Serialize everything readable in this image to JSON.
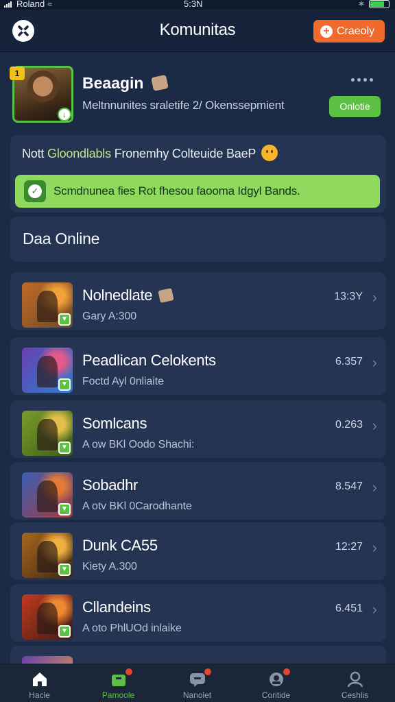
{
  "status_bar": {
    "carrier": "Roland",
    "time": "5:3N",
    "battery_level": 0.78,
    "battery_color": "#3ecf4a"
  },
  "header": {
    "title": "Komunitas",
    "create_label": "Craeoly",
    "create_color": "#ef6a2c"
  },
  "profile": {
    "name": "Beaagin",
    "subtitle": "Meltnnunites sraletife 2/ Okenssepmient",
    "status": "Onlotie",
    "avatar_badge": "1"
  },
  "notice": {
    "prefix": "Nott ",
    "highlight": "Gloondlabls",
    "rest": " Fronemhy Colteuide BaeP",
    "banner": "Scmdnunea fies Rot fhesou faooma Idgyl Bands."
  },
  "section": {
    "title": "Daa Online"
  },
  "list": [
    {
      "title": "Nolnedlate",
      "subtitle": "Gary A:300",
      "count": "13:3Y",
      "badge": true,
      "colors": [
        "#c06a2a",
        "#6d4a22",
        "#f2a23a"
      ]
    },
    {
      "title": "Peadlican Celokents",
      "subtitle": "Foctd Ayl 0nliaite",
      "count": "6.357",
      "badge": false,
      "colors": [
        "#6a3fb0",
        "#2a7fd0",
        "#e25b8a"
      ]
    },
    {
      "title": "Somlcans",
      "subtitle": "A ow BKl Oodo Shachi:",
      "count": "0.263",
      "badge": false,
      "colors": [
        "#7a9b2a",
        "#3a5d18",
        "#e4c04a"
      ]
    },
    {
      "title": "Sobadhr",
      "subtitle": "A otv BKl 0Carodhante",
      "count": "8.547",
      "badge": false,
      "colors": [
        "#3c5fb6",
        "#a23a3a",
        "#e27a3a"
      ]
    },
    {
      "title": "Dunk CA55",
      "subtitle": "Kiety A.300",
      "count": "12:27",
      "badge": false,
      "colors": [
        "#a8661e",
        "#3b2814",
        "#f0b040"
      ]
    },
    {
      "title": "Cllandeins",
      "subtitle": "A oto PhlUOd inlaike",
      "count": "6.451",
      "badge": false,
      "colors": [
        "#c23a1e",
        "#3b1a18",
        "#f08a30"
      ]
    }
  ],
  "bottom_nav": [
    {
      "label": "Hacle",
      "icon": "home-icon",
      "active": false,
      "dot": false
    },
    {
      "label": "Pamoole",
      "icon": "community-icon",
      "active": true,
      "dot": true
    },
    {
      "label": "Nanolet",
      "icon": "chat-icon",
      "active": false,
      "dot": true
    },
    {
      "label": "Coritide",
      "icon": "messages-icon",
      "active": false,
      "dot": true
    },
    {
      "label": "Ceshlis",
      "icon": "profile-icon",
      "active": false,
      "dot": false
    }
  ]
}
